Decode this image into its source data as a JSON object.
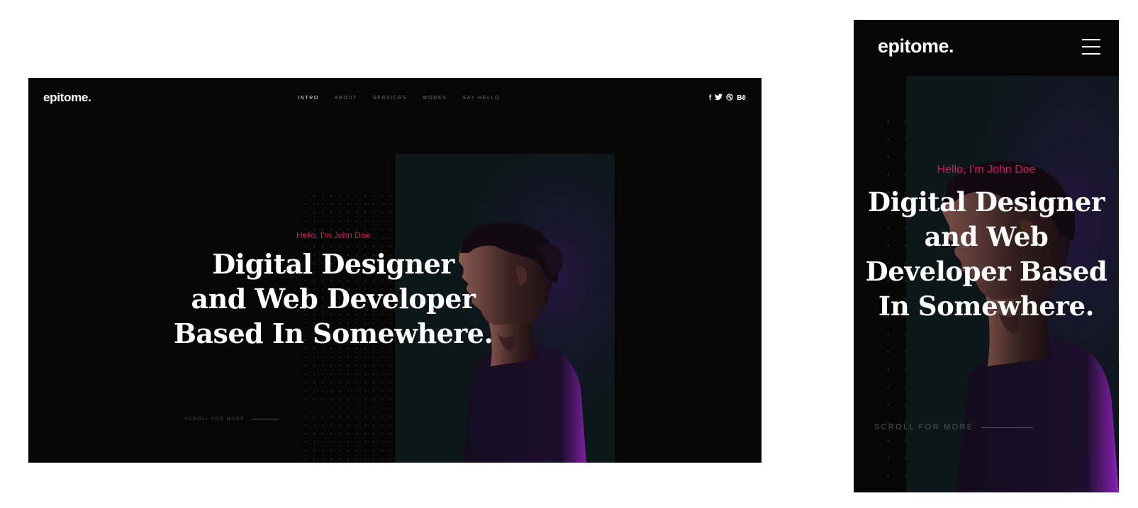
{
  "brand": {
    "logo": "epitome."
  },
  "nav": {
    "items": [
      {
        "label": "INTRO",
        "active": true
      },
      {
        "label": "ABOUT",
        "active": false
      },
      {
        "label": "SERVICES",
        "active": false
      },
      {
        "label": "WORKS",
        "active": false
      },
      {
        "label": "SAY HELLO",
        "active": false
      }
    ]
  },
  "social": [
    {
      "icon": "facebook-icon",
      "glyph": "f"
    },
    {
      "icon": "twitter-icon",
      "glyph": "🐦"
    },
    {
      "icon": "dribbble-icon",
      "glyph": "⊛"
    },
    {
      "icon": "behance-icon",
      "glyph": "Bē"
    }
  ],
  "hero": {
    "greeting": "Hello, I'm John Doe",
    "desktop_lines": [
      "Digital Designer",
      "and Web Developer",
      "Based In Somewhere."
    ],
    "mobile_lines": [
      "Digital Designer",
      "and Web",
      "Developer Based",
      "In Somewhere."
    ],
    "scroll_label": "SCROLL FOR MORE"
  },
  "colors": {
    "accent": "#d9145f",
    "background": "#060606",
    "photo_bg": "#0b1718",
    "text": "#ffffff"
  }
}
